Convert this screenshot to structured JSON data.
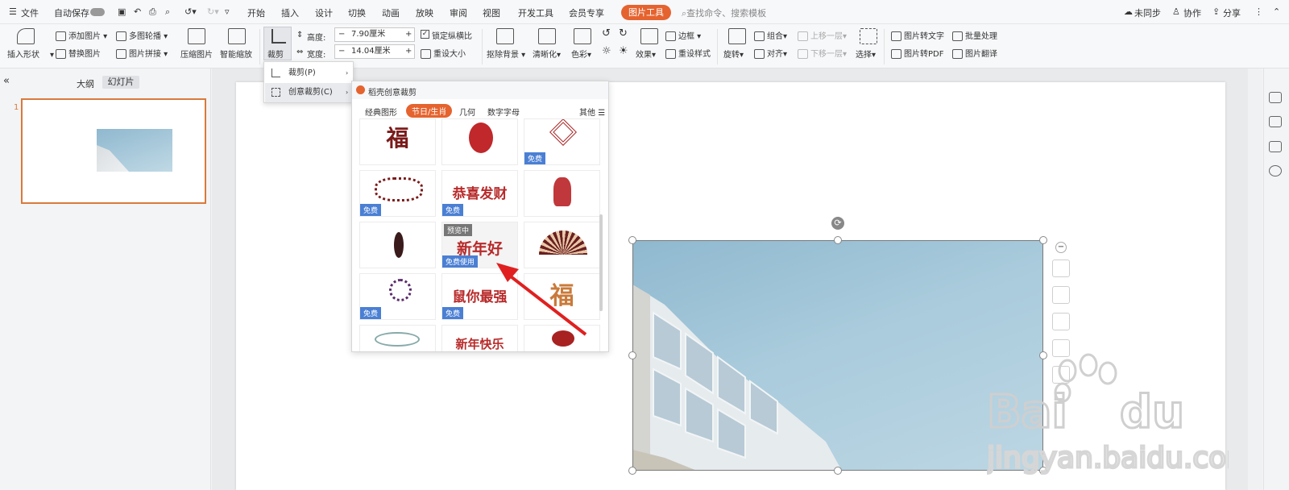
{
  "topbar": {
    "menu_label": "文件",
    "autosave_label": "自动保存",
    "tabs": [
      "开始",
      "插入",
      "设计",
      "切换",
      "动画",
      "放映",
      "审阅",
      "视图",
      "开发工具",
      "会员专享"
    ],
    "active_tab": "图片工具",
    "search_placeholder": "查找命令、搜索模板",
    "sync_label": "未同步",
    "collab_label": "协作",
    "share_label": "分享"
  },
  "ribbon": {
    "insert_shape": "插入形状",
    "add_picture": "添加图片",
    "replace_picture": "替换图片",
    "multi_carousel": "多图轮播",
    "picture_splice": "图片拼接",
    "compress_picture": "压缩图片",
    "smart_zoom": "智能缩放",
    "crop": "裁剪",
    "height_label": "高度:",
    "height_value": "7.90厘米",
    "width_label": "宽度:",
    "width_value": "14.04厘米",
    "lock_ratio": "锁定纵横比",
    "reset_size": "重设大小",
    "remove_bg": "抠除背景",
    "sharpen": "清晰化",
    "color": "色彩",
    "effects": "效果",
    "reset_style": "重设样式",
    "border": "边框",
    "rotate": "旋转",
    "combine": "组合",
    "align": "对齐",
    "bring_forward": "上移一层",
    "send_backward": "下移一层",
    "select": "选择",
    "pic_to_text": "图片转文字",
    "batch_process": "批量处理",
    "pic_to_pdf": "图片转PDF",
    "pic_translate": "图片翻译"
  },
  "leftpanel": {
    "tab_outline": "大纲",
    "tab_slides": "幻灯片",
    "slide_number": "1"
  },
  "crop_menu": {
    "items": [
      "裁剪(P)",
      "创意裁剪(C)"
    ]
  },
  "creative_panel": {
    "title": "稻壳创意裁剪",
    "tabs": [
      "经典图形",
      "节日/生肖",
      "几何",
      "数字字母"
    ],
    "more_label": "其他",
    "badge_free": "免费",
    "badge_free_use": "免费使用",
    "badge_preview": "预览中",
    "cell_texts": {
      "fu": "福",
      "gongxi": "恭喜发财",
      "xinnian": "新年好",
      "shuni": "鼠你最强",
      "kuaile": "新年快乐"
    }
  },
  "colors": {
    "accent": "#e5632f",
    "badge": "#4a7fd4",
    "thumb_border": "#d87a3b",
    "arrow": "#e02020"
  }
}
